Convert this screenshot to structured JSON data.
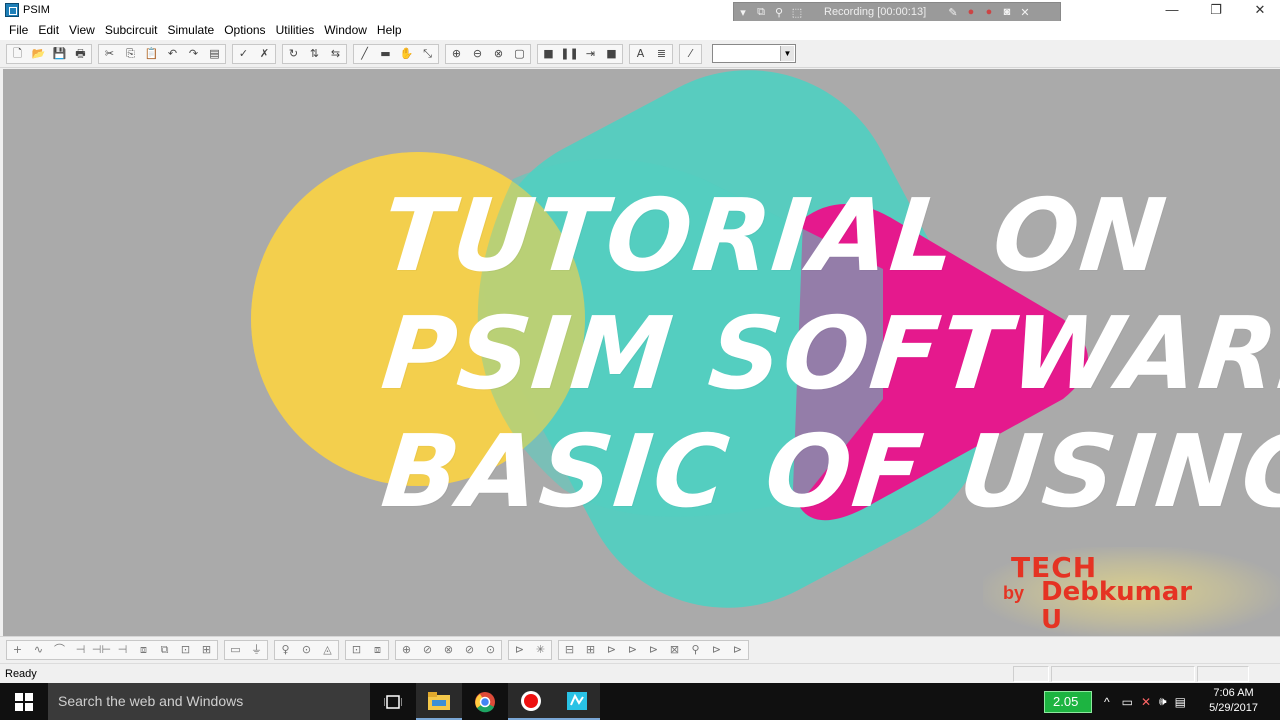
{
  "window": {
    "title": "PSIM",
    "minimize": "—",
    "restore": "❐",
    "close": "✕"
  },
  "recorder": {
    "status": "Recording [00:00:13]",
    "icons": [
      "dropdown-icon",
      "window-icon",
      "zoom-icon",
      "region-icon",
      "pen-icon",
      "record-icon",
      "stop-icon",
      "camera-icon",
      "close-icon"
    ]
  },
  "menu": {
    "items": [
      "File",
      "Edit",
      "View",
      "Subcircuit",
      "Simulate",
      "Options",
      "Utilities",
      "Window",
      "Help"
    ]
  },
  "toolbar_top": {
    "groups": [
      [
        "🗋",
        "📂",
        "💾",
        "🖶"
      ],
      [
        "✂",
        "⎘",
        "📋",
        "↶",
        "↷",
        "▤"
      ],
      [
        "✓",
        "✗"
      ],
      [
        "↻",
        "⇅",
        "⇆"
      ],
      [
        "╱",
        "▬",
        "✋",
        "⤡"
      ],
      [
        "⊕",
        "⊖",
        "⊗",
        "▢"
      ],
      [
        "■",
        "❚❚",
        "⇥",
        "■"
      ],
      [
        "A",
        "≣"
      ],
      [
        "⁄"
      ]
    ],
    "combo_value": ""
  },
  "toolbar_bottom": {
    "groups": [
      [
        "+",
        "∿",
        "⌒",
        "⊣",
        "⊣⊢",
        "⊣",
        "⧈",
        "⧉",
        "⊡",
        "⊞"
      ],
      [
        "▭",
        "⏚"
      ],
      [
        "♀",
        "⊙",
        "◬"
      ],
      [
        "⊡",
        "⧈"
      ],
      [
        "⊕",
        "⊘",
        "⊗",
        "⊘",
        "⊙"
      ],
      [
        "⊳",
        "✳"
      ],
      [
        "⊟",
        "⊞",
        "⊳",
        "⊳",
        "⊳",
        "⊠",
        "⚲",
        "⊳",
        "⊳"
      ]
    ]
  },
  "canvas": {
    "headline": [
      "TUTORIAL ON",
      "PSIM SOFTWARE",
      "BASIC OF USING"
    ],
    "brand": {
      "tech": "TECH",
      "by": "by",
      "name": "Debkumar",
      "u": "U"
    },
    "colors": {
      "background": "#aaaaaa",
      "yellow": "#f5d04a",
      "teal": "#52cfc1",
      "magenta": "#e5198d",
      "brand_red": "#e53323"
    }
  },
  "status": {
    "text": "Ready"
  },
  "taskbar": {
    "search_placeholder": "Search the web and Windows",
    "apps": [
      "task-view-icon",
      "file-explorer-icon",
      "chrome-icon",
      "recorder-icon",
      "psim-icon"
    ],
    "battery_badge": "2.05",
    "time": "7:06 AM",
    "date": "5/29/2017"
  }
}
